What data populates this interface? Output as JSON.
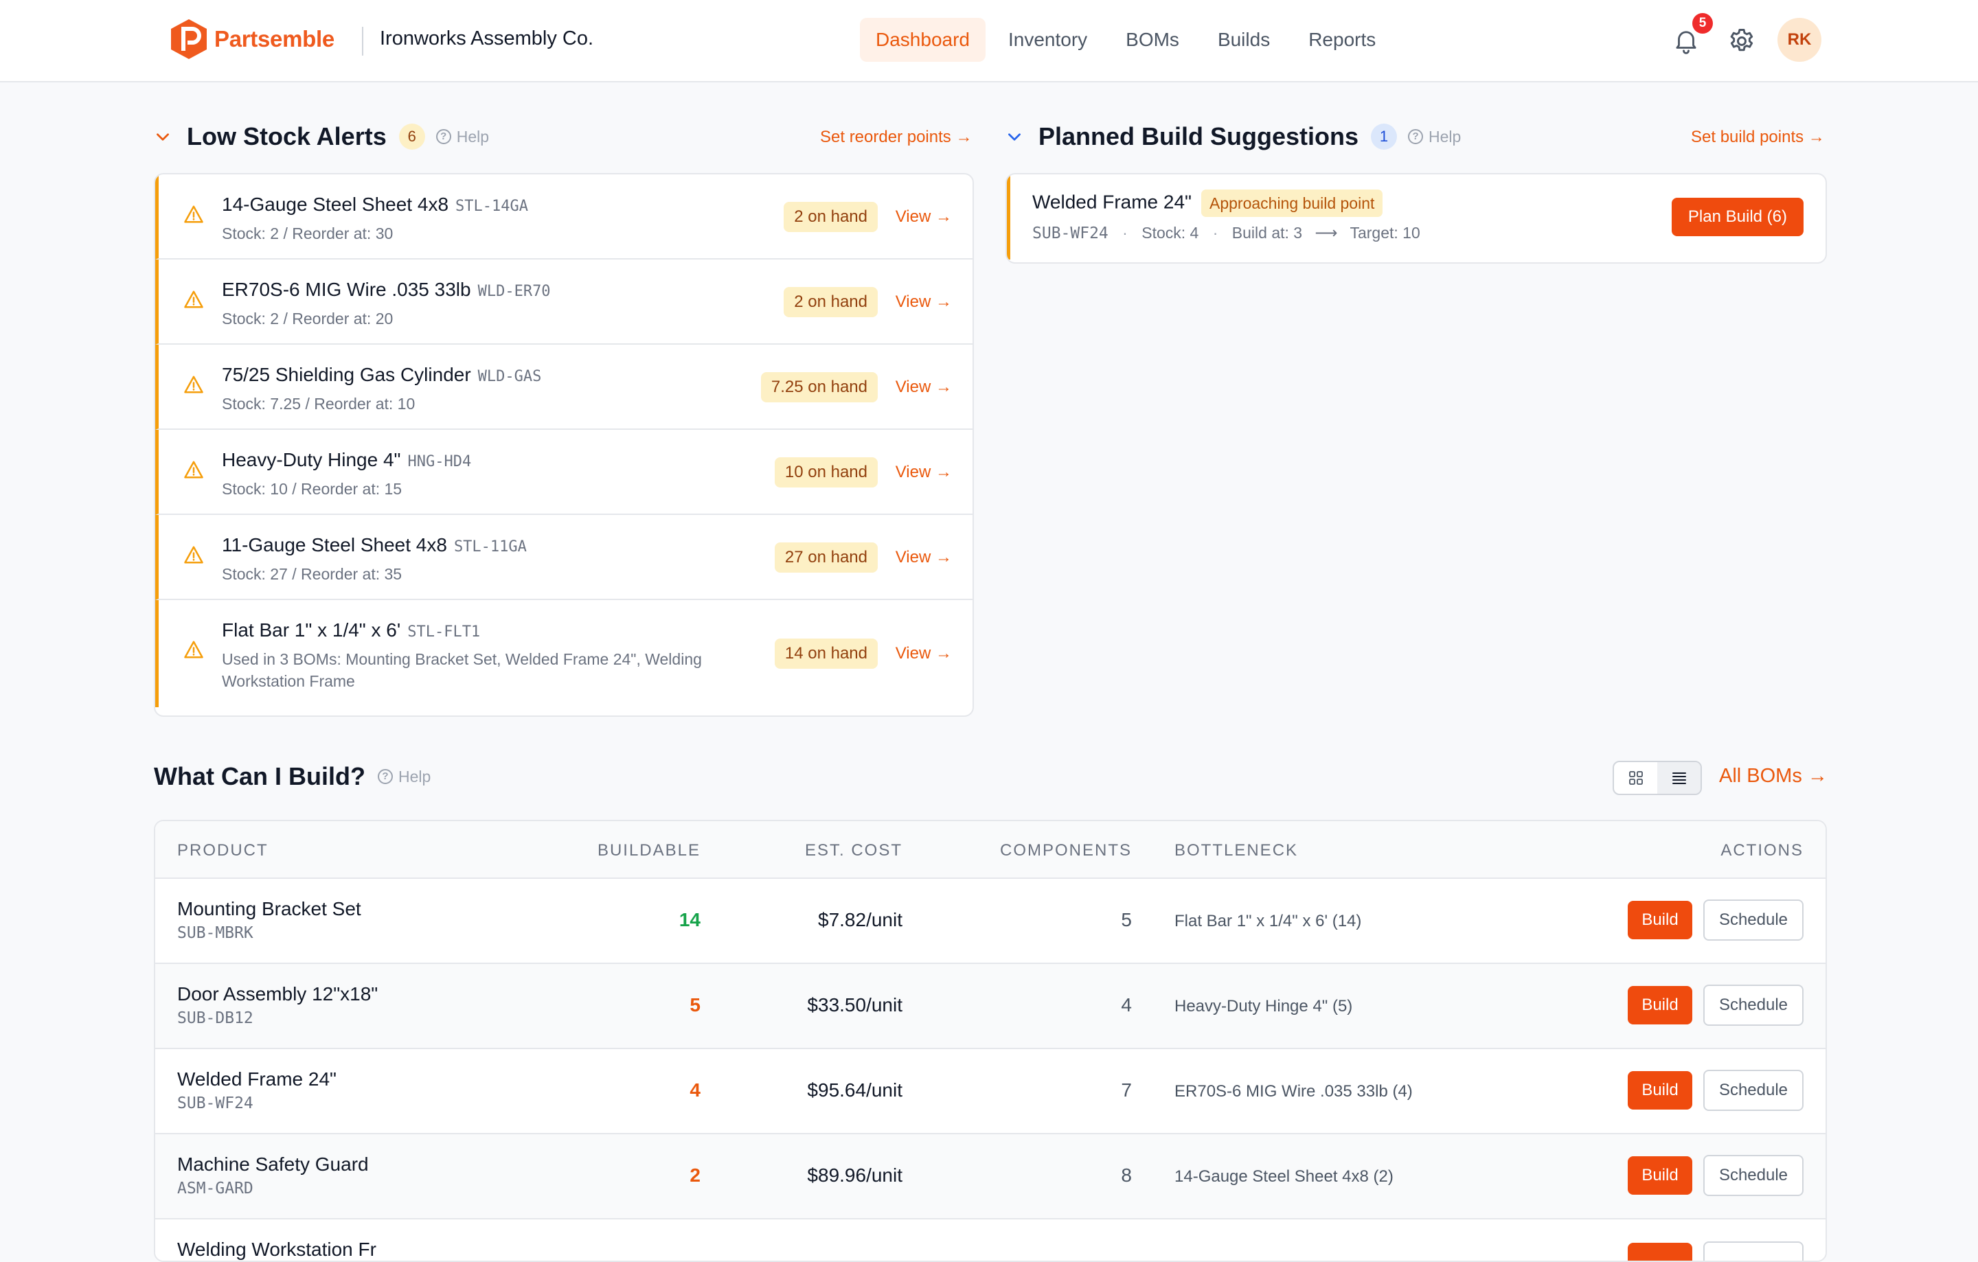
{
  "header": {
    "brand": "Partsemble",
    "org": "Ironworks Assembly Co.",
    "nav": [
      "Dashboard",
      "Inventory",
      "BOMs",
      "Builds",
      "Reports"
    ],
    "active_nav": "Dashboard",
    "notifications": "5",
    "avatar_initials": "RK"
  },
  "low_stock": {
    "title": "Low Stock Alerts",
    "count": "6",
    "help": "Help",
    "link": "Set reorder points →",
    "items": [
      {
        "name": "14-Gauge Steel Sheet 4x8",
        "sku": "STL-14GA",
        "sub": "Stock: 2 / Reorder at: 30",
        "onhand": "2 on hand",
        "view": "View →"
      },
      {
        "name": "ER70S-6 MIG Wire .035 33lb",
        "sku": "WLD-ER70",
        "sub": "Stock: 2 / Reorder at: 20",
        "onhand": "2 on hand",
        "view": "View →"
      },
      {
        "name": "75/25 Shielding Gas Cylinder",
        "sku": "WLD-GAS",
        "sub": "Stock: 7.25 / Reorder at: 10",
        "onhand": "7.25 on hand",
        "view": "View →"
      },
      {
        "name": "Heavy-Duty Hinge 4\"",
        "sku": "HNG-HD4",
        "sub": "Stock: 10 / Reorder at: 15",
        "onhand": "10 on hand",
        "view": "View →"
      },
      {
        "name": "11-Gauge Steel Sheet 4x8",
        "sku": "STL-11GA",
        "sub": "Stock: 27 / Reorder at: 35",
        "onhand": "27 on hand",
        "view": "View →"
      },
      {
        "name": "Flat Bar 1\" x 1/4\" x 6'",
        "sku": "STL-FLT1",
        "sub": "Used in 3 BOMs: Mounting Bracket Set, Welded Frame 24\", Welding Workstation Frame",
        "onhand": "14 on hand",
        "view": "View →"
      }
    ]
  },
  "planned": {
    "title": "Planned Build Suggestions",
    "count": "1",
    "help": "Help",
    "link": "Set build points →",
    "item": {
      "name": "Welded Frame 24\"",
      "status": "Approaching build point",
      "sku": "SUB-WF24",
      "stock": "Stock: 4",
      "build_at": "Build at: 3",
      "arrow": "⟶",
      "target": "Target: 10",
      "button": "Plan Build (6)"
    }
  },
  "build": {
    "title": "What Can I Build?",
    "help": "Help",
    "link": "All BOMs →",
    "columns": [
      "PRODUCT",
      "BUILDABLE",
      "EST. COST",
      "COMPONENTS",
      "BOTTLENECK",
      "ACTIONS"
    ],
    "rows": [
      {
        "name": "Mounting Bracket Set",
        "sku": "SUB-MBRK",
        "buildable": "14",
        "color": "#16a34a",
        "cost": "$7.82/unit",
        "components": "5",
        "bottleneck": "Flat Bar 1\" x 1/4\" x 6' (14)",
        "build": "Build",
        "schedule": "Schedule"
      },
      {
        "name": "Door Assembly 12\"x18\"",
        "sku": "SUB-DB12",
        "buildable": "5",
        "color": "#ea580c",
        "cost": "$33.50/unit",
        "components": "4",
        "bottleneck": "Heavy-Duty Hinge 4\" (5)",
        "build": "Build",
        "schedule": "Schedule"
      },
      {
        "name": "Welded Frame 24\"",
        "sku": "SUB-WF24",
        "buildable": "4",
        "color": "#ea580c",
        "cost": "$95.64/unit",
        "components": "7",
        "bottleneck": "ER70S-6 MIG Wire .035 33lb (4)",
        "build": "Build",
        "schedule": "Schedule"
      },
      {
        "name": "Machine Safety Guard",
        "sku": "ASM-GARD",
        "buildable": "2",
        "color": "#ea580c",
        "cost": "$89.96/unit",
        "components": "8",
        "bottleneck": "14-Gauge Steel Sheet 4x8 (2)",
        "build": "Build",
        "schedule": "Schedule"
      },
      {
        "name": "Welding Workstation Fr",
        "sku": "",
        "buildable": "",
        "color": "#ea580c",
        "cost": "",
        "components": "",
        "bottleneck": "",
        "build": "",
        "schedule": ""
      }
    ]
  }
}
